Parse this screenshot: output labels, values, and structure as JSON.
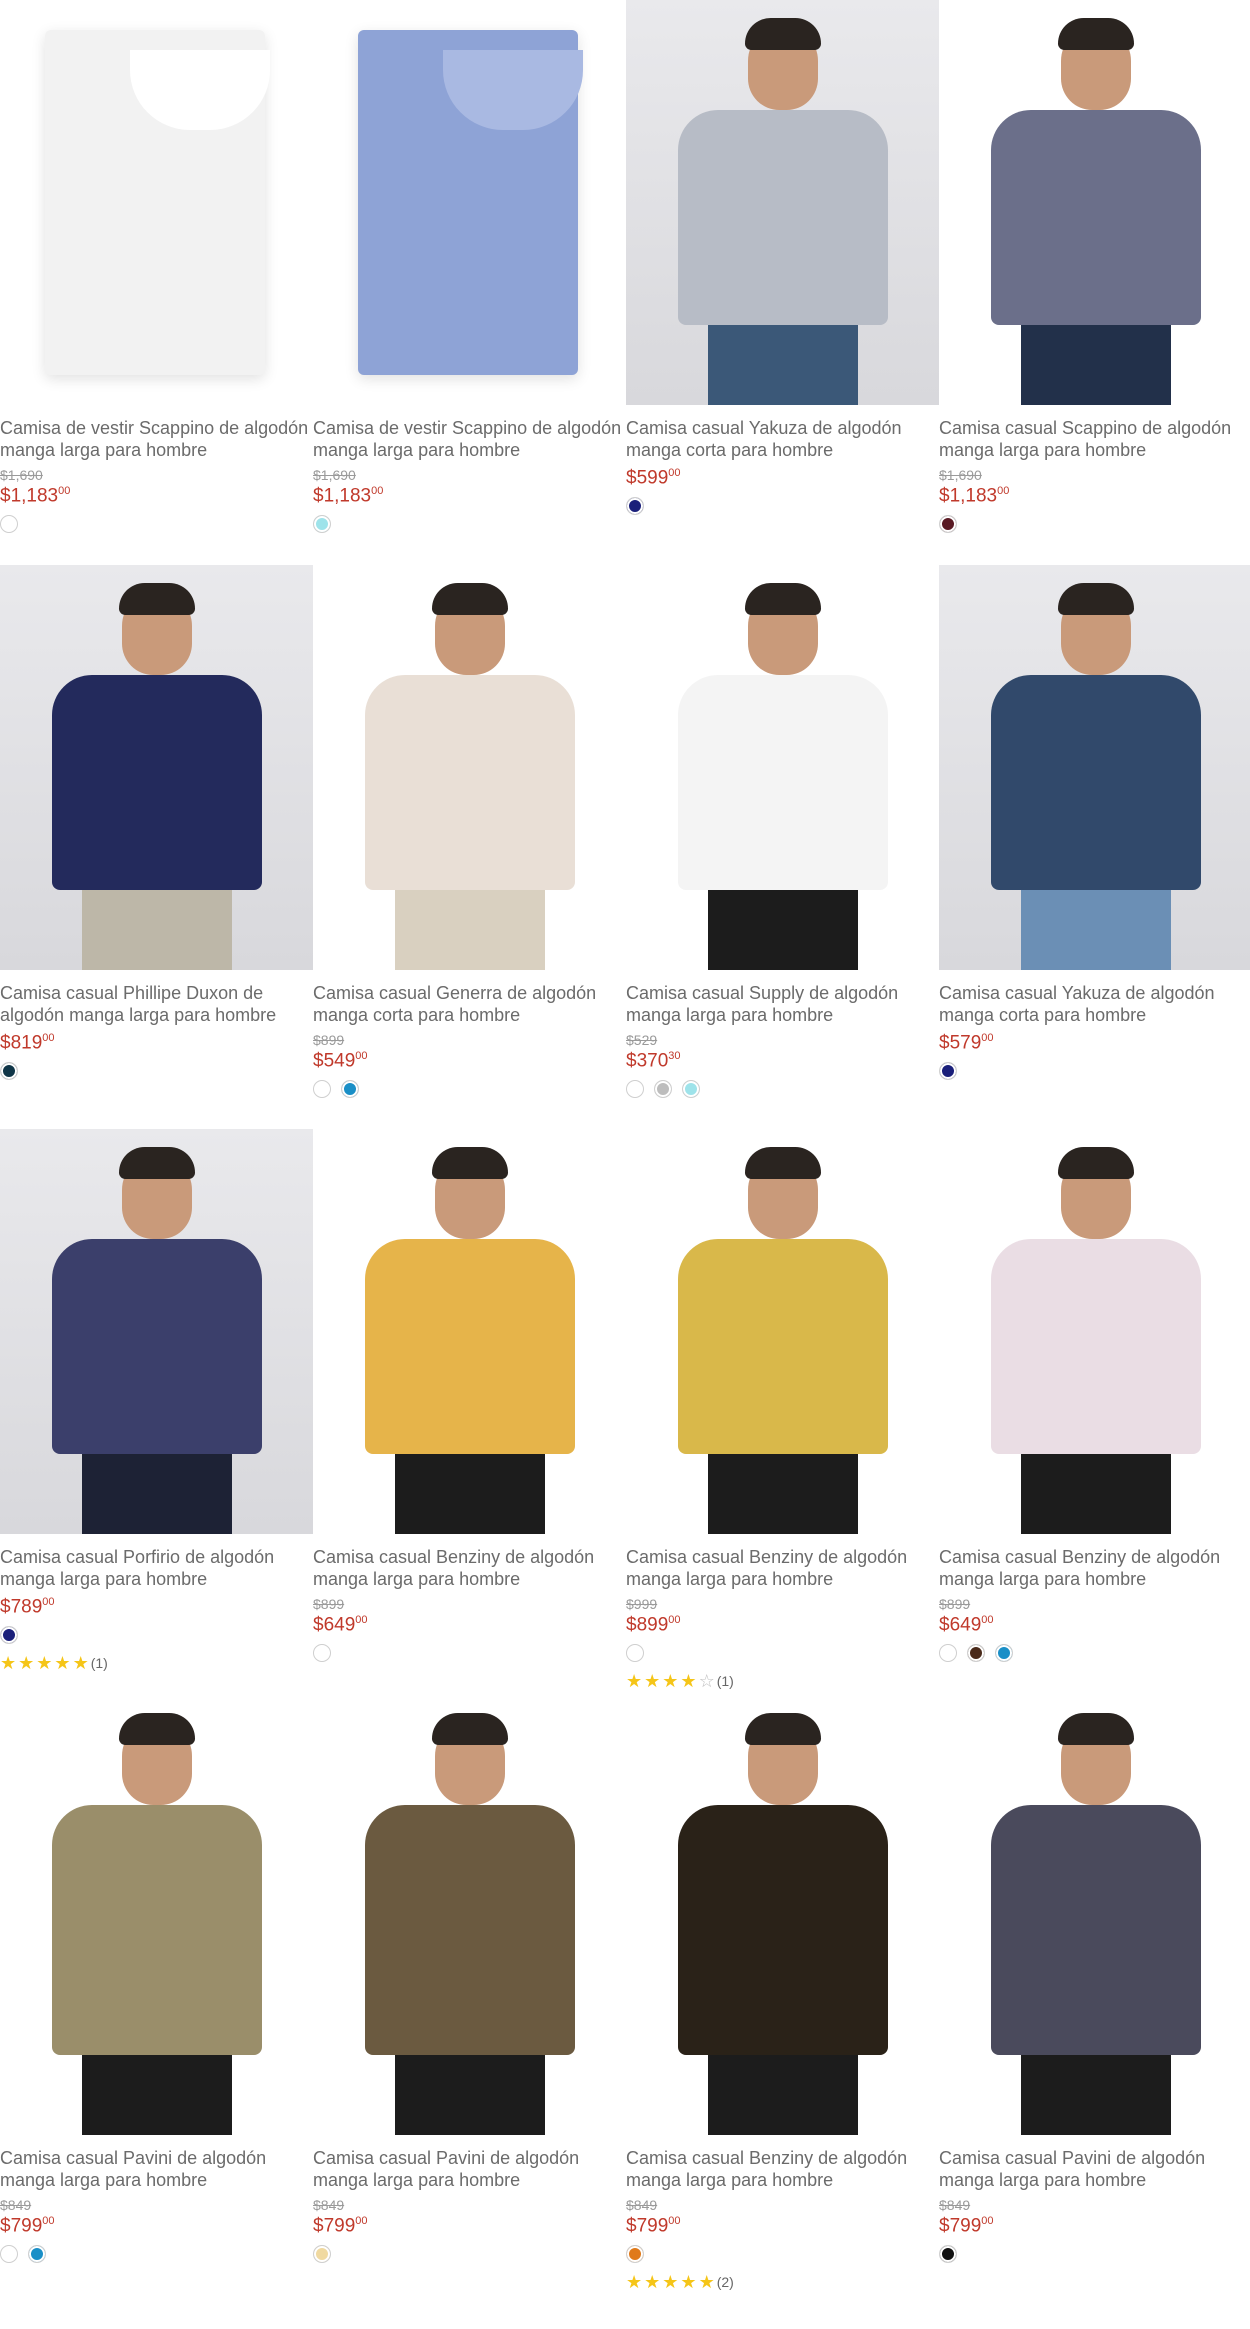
{
  "products": [
    {
      "title": "Camisa de vestir Scappino de algodón manga larga para hombre",
      "old_price": "$1,690",
      "price": "$1,183",
      "cents": "00",
      "swatches": [
        "#ffffff"
      ],
      "image": "white folded dress shirt"
    },
    {
      "title": "Camisa de vestir Scappino de algodón manga larga para hombre",
      "old_price": "$1,690",
      "price": "$1,183",
      "cents": "00",
      "swatches": [
        "#9ee3ea"
      ],
      "image": "blue folded dress shirt"
    },
    {
      "title": "Camisa casual Yakuza de algodón manga corta para hombre",
      "old_price": "",
      "price": "$599",
      "cents": "00",
      "swatches": [
        "#1a1f7a"
      ],
      "image": "man in grey short sleeve shirt"
    },
    {
      "title": "Camisa casual Scappino de algodón manga larga para hombre",
      "old_price": "$1,690",
      "price": "$1,183",
      "cents": "00",
      "swatches": [
        "#5a1a24"
      ],
      "image": "man in checked shirt"
    },
    {
      "title": "Camisa casual Phillipe Duxon de algodón manga larga para hombre",
      "old_price": "",
      "price": "$819",
      "cents": "00",
      "swatches": [
        "#0f3547"
      ],
      "image": "man in navy shirt"
    },
    {
      "title": "Camisa casual Generra de algodón manga corta para hombre",
      "old_price": "$899",
      "price": "$549",
      "cents": "00",
      "swatches": [
        "#ffffff",
        "#1a8fc7"
      ],
      "image": "man in floral shirt"
    },
    {
      "title": "Camisa casual Supply de algodón manga larga para hombre",
      "old_price": "$529",
      "price": "$370",
      "cents": "30",
      "swatches": [
        "#ffffff",
        "#bdbdbd",
        "#9ee3ea"
      ],
      "image": "man in white shirt"
    },
    {
      "title": "Camisa casual Yakuza de algodón manga corta para hombre",
      "old_price": "",
      "price": "$579",
      "cents": "00",
      "swatches": [
        "#1a1f7a"
      ],
      "image": "man in blue printed shirt"
    },
    {
      "title": "Camisa casual Porfirio de algodón manga larga para hombre",
      "old_price": "",
      "price": "$789",
      "cents": "00",
      "swatches": [
        "#1a1f7a"
      ],
      "rating": 5,
      "reviews": "(1)",
      "image": "man in plaid shirt"
    },
    {
      "title": "Camisa casual Benziny de algodón manga larga para hombre",
      "old_price": "$899",
      "price": "$649",
      "cents": "00",
      "swatches": [
        "#ffffff"
      ],
      "image": "baroque gold print shirt"
    },
    {
      "title": "Camisa casual Benziny de algodón manga larga para hombre",
      "old_price": "$999",
      "price": "$899",
      "cents": "00",
      "swatches": [
        "#ffffff"
      ],
      "rating": 4,
      "reviews": "(1)",
      "image": "striped gold print shirt"
    },
    {
      "title": "Camisa casual Benziny de algodón manga larga para hombre",
      "old_price": "$899",
      "price": "$649",
      "cents": "00",
      "swatches": [
        "#ffffff",
        "#4a2a1a",
        "#1a8fc7"
      ],
      "image": "white printed shirt"
    },
    {
      "title": "Camisa casual Pavini de algodón manga larga para hombre",
      "old_price": "$849",
      "price": "$799",
      "cents": "00",
      "swatches": [
        "#ffffff",
        "#1a8fc7"
      ],
      "image": "man in metallic plaid shirt"
    },
    {
      "title": "Camisa casual Pavini de algodón manga larga para hombre",
      "old_price": "$849",
      "price": "$799",
      "cents": "00",
      "swatches": [
        "#f0d9a0"
      ],
      "image": "man in striped print shirt"
    },
    {
      "title": "Camisa casual Benziny de algodón manga larga para hombre",
      "old_price": "$849",
      "price": "$799",
      "cents": "00",
      "swatches": [
        "#e07a1a"
      ],
      "rating": 5,
      "reviews": "(2)",
      "image": "man in black gold print shirt"
    },
    {
      "title": "Camisa casual Pavini de algodón manga larga para hombre",
      "old_price": "$849",
      "price": "$799",
      "cents": "00",
      "swatches": [
        "#111111"
      ],
      "image": "man in grey shirt"
    }
  ]
}
